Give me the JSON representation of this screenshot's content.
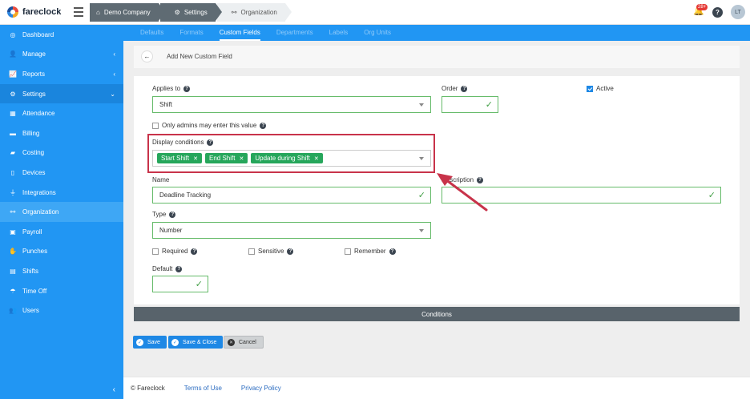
{
  "app": {
    "name": "fareclock"
  },
  "breadcrumbs": [
    {
      "label": "Demo Company"
    },
    {
      "label": "Settings"
    },
    {
      "label": "Organization"
    }
  ],
  "topbar": {
    "notifications_count": "28+",
    "help": "?",
    "avatar_initials": "LT"
  },
  "sidebar": {
    "items": [
      {
        "label": "Dashboard"
      },
      {
        "label": "Manage"
      },
      {
        "label": "Reports"
      },
      {
        "label": "Settings"
      },
      {
        "label": "Attendance"
      },
      {
        "label": "Billing"
      },
      {
        "label": "Costing"
      },
      {
        "label": "Devices"
      },
      {
        "label": "Integrations"
      },
      {
        "label": "Organization"
      },
      {
        "label": "Payroll"
      },
      {
        "label": "Punches"
      },
      {
        "label": "Shifts"
      },
      {
        "label": "Time Off"
      },
      {
        "label": "Users"
      }
    ]
  },
  "tabs": [
    {
      "label": "Defaults"
    },
    {
      "label": "Formats"
    },
    {
      "label": "Custom Fields"
    },
    {
      "label": "Departments"
    },
    {
      "label": "Labels"
    },
    {
      "label": "Org Units"
    }
  ],
  "form": {
    "title": "Add New Custom Field",
    "applies_to_label": "Applies to",
    "applies_to_value": "Shift",
    "order_label": "Order",
    "order_value": "",
    "active_label": "Active",
    "admins_only_label": "Only admins may enter this value",
    "display_conditions_label": "Display conditions",
    "display_conditions": [
      "Start Shift",
      "End Shift",
      "Update during Shift"
    ],
    "name_label": "Name",
    "name_value": "Deadline Tracking",
    "description_label": "Description",
    "description_value": "",
    "type_label": "Type",
    "type_value": "Number",
    "required_label": "Required",
    "sensitive_label": "Sensitive",
    "remember_label": "Remember",
    "default_label": "Default",
    "default_value": ""
  },
  "conditions_label": "Conditions",
  "buttons": {
    "save": "Save",
    "save_close": "Save & Close",
    "cancel": "Cancel"
  },
  "footer": {
    "copyright": "© Fareclock",
    "terms": "Terms of Use",
    "privacy": "Privacy Policy"
  },
  "colors": {
    "sidebar": "#2196f3",
    "highlight": "#c8334a",
    "tag": "#26a65b"
  }
}
